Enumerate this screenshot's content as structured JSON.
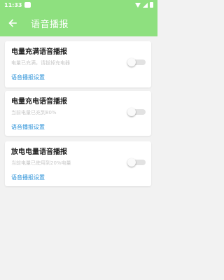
{
  "status_bar": {
    "time": "11:33"
  },
  "toolbar": {
    "title": "语音播报"
  },
  "cards": [
    {
      "title": "电量充满语音播报",
      "description": "电量已充满，请拔掉充电器",
      "link": "语音播报设置",
      "enabled": false
    },
    {
      "title": "电量充电语音播报",
      "description": "当前电量已充到80%",
      "link": "语音播报设置",
      "enabled": false
    },
    {
      "title": "放电电量语音播报",
      "description": "当前电量已使用到20%电量",
      "link": "语音播报设置",
      "enabled": false
    }
  ],
  "colors": {
    "accent": "#8ee07f",
    "link": "#2e93d9"
  },
  "icons": {
    "back": "arrow-left-icon"
  }
}
